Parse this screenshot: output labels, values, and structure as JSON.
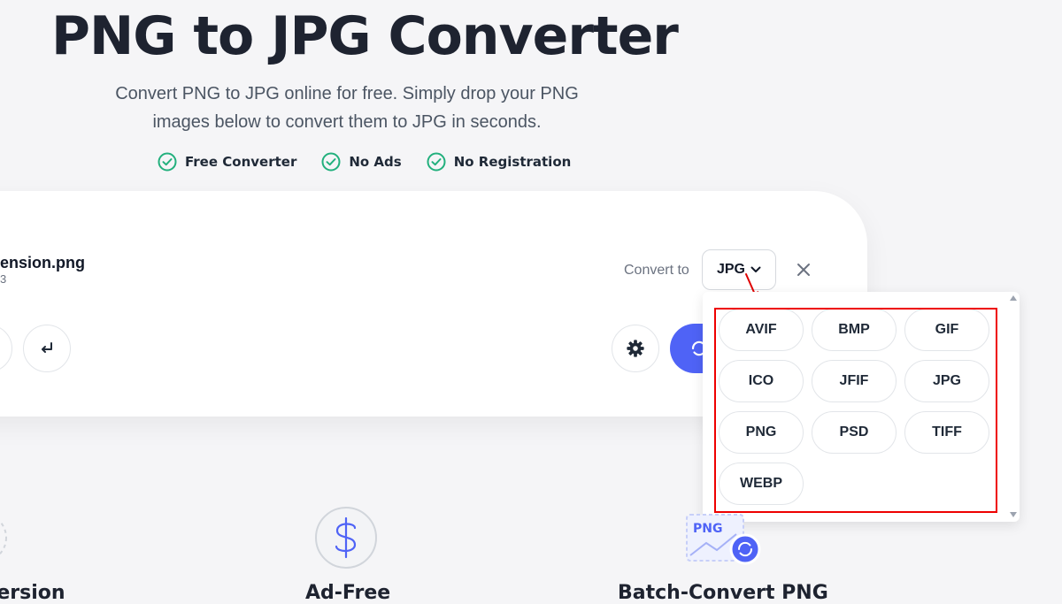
{
  "hero": {
    "title": "PNG to JPG Converter",
    "subtitle_line1": "Convert PNG to JPG online for free. Simply drop your PNG",
    "subtitle_line2": "images below to convert them to JPG in seconds."
  },
  "features": [
    "Free Converter",
    "No Ads",
    "No Registration"
  ],
  "file": {
    "name": "ension.png",
    "size": "3"
  },
  "converter": {
    "convert_to_label": "Convert to",
    "selected_format": "JPG"
  },
  "dropdown": {
    "formats": [
      "AVIF",
      "BMP",
      "GIF",
      "ICO",
      "JFIF",
      "JPG",
      "PNG",
      "PSD",
      "TIFF",
      "WEBP"
    ]
  },
  "bottom": {
    "label1": "version",
    "label2": "Ad-Free",
    "label3": "Batch-Convert PNG",
    "png_icon_text": "PNG"
  },
  "colors": {
    "accent": "#4f63f6",
    "check_green": "#22b07d",
    "annotation_red": "#e00000"
  }
}
